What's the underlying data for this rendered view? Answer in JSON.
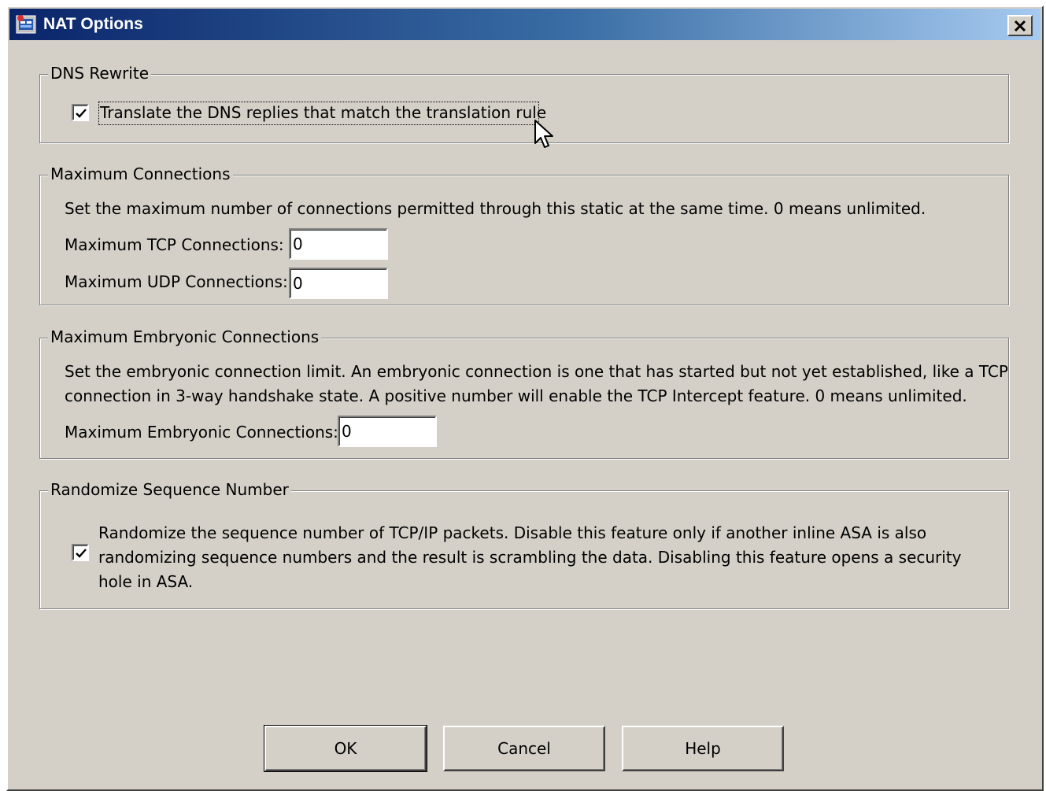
{
  "window": {
    "title": "NAT Options",
    "icon": "asdm-app-icon",
    "close_icon": "close-icon"
  },
  "dns_rewrite": {
    "legend": "DNS Rewrite",
    "checkbox_label": "Translate the DNS replies that match the translation rule",
    "checked": true
  },
  "max_connections": {
    "legend": "Maximum Connections",
    "description": "Set the maximum number of connections permitted through this static at the same time. 0 means unlimited.",
    "tcp_label": "Maximum TCP Connections:",
    "tcp_value": "0",
    "udp_label": "Maximum UDP Connections:",
    "udp_value": "0"
  },
  "embryonic": {
    "legend": "Maximum Embryonic Connections",
    "description_line1": "Set the embryonic connection limit. An embryonic connection is one that has started but not yet established, like a TCP",
    "description_line2": "connection in 3-way handshake state. A positive number will enable the TCP Intercept feature. 0 means unlimited.",
    "label": "Maximum Embryonic Connections:",
    "value": "0"
  },
  "randomize": {
    "legend": "Randomize Sequence Number",
    "line1": "Randomize the sequence number of TCP/IP packets. Disable this feature only if another inline ASA is also",
    "line2": "randomizing sequence numbers and the result is scrambling the data. Disabling this feature opens a security",
    "line3": "hole in ASA.",
    "checked": true
  },
  "buttons": {
    "ok": "OK",
    "cancel": "Cancel",
    "help": "Help"
  }
}
